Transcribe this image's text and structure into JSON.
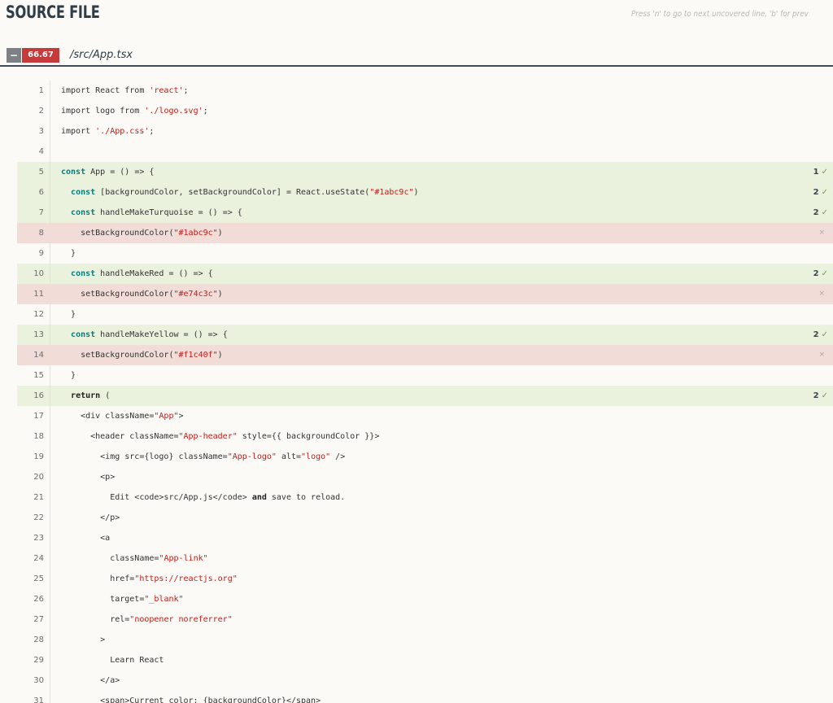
{
  "header": {
    "title": "SOURCE FILE",
    "hint": "Press 'n' to go to next uncovered line, 'b' for previous uncovered line"
  },
  "file": {
    "toggle_label": "−",
    "coverage_percent": "66.67",
    "path": "/src/App.tsx"
  },
  "colors": {
    "covered_bg": "#eaf1dd",
    "uncovered_bg": "#f1dcd8",
    "percent_badge": "#c53b3b"
  },
  "lines": [
    {
      "n": "1",
      "state": "",
      "hits": "",
      "tokens": [
        [
          "import React from ",
          ""
        ],
        [
          "'react'",
          "str"
        ],
        [
          ";",
          ""
        ]
      ]
    },
    {
      "n": "2",
      "state": "",
      "hits": "",
      "tokens": [
        [
          "import logo from ",
          ""
        ],
        [
          "'./logo.svg'",
          "str"
        ],
        [
          ";",
          ""
        ]
      ]
    },
    {
      "n": "3",
      "state": "",
      "hits": "",
      "tokens": [
        [
          "import ",
          ""
        ],
        [
          "'./App.css'",
          "str"
        ],
        [
          ";",
          ""
        ]
      ]
    },
    {
      "n": "4",
      "state": "",
      "hits": "",
      "tokens": []
    },
    {
      "n": "5",
      "state": "covered",
      "hits": "1",
      "tokens": [
        [
          "const",
          "kw"
        ],
        [
          " App = () => {",
          ""
        ]
      ]
    },
    {
      "n": "6",
      "state": "covered",
      "hits": "2",
      "tokens": [
        [
          "  ",
          ""
        ],
        [
          "const",
          "kw"
        ],
        [
          " [backgroundColor, setBackgroundColor] = React.useState(",
          ""
        ],
        [
          "\"#1abc9c\"",
          "str"
        ],
        [
          ")",
          ""
        ]
      ]
    },
    {
      "n": "7",
      "state": "covered",
      "hits": "2",
      "tokens": [
        [
          "  ",
          ""
        ],
        [
          "const",
          "kw"
        ],
        [
          " handleMakeTurquoise = () => {",
          ""
        ]
      ]
    },
    {
      "n": "8",
      "state": "uncovered",
      "hits": "",
      "tokens": [
        [
          "    setBackgroundColor(",
          ""
        ],
        [
          "\"#1abc9c\"",
          "str"
        ],
        [
          ")",
          ""
        ]
      ]
    },
    {
      "n": "9",
      "state": "",
      "hits": "",
      "tokens": [
        [
          "  }",
          ""
        ]
      ]
    },
    {
      "n": "10",
      "state": "covered",
      "hits": "2",
      "tokens": [
        [
          "  ",
          ""
        ],
        [
          "const",
          "kw"
        ],
        [
          " handleMakeRed = () => {",
          ""
        ]
      ]
    },
    {
      "n": "11",
      "state": "uncovered",
      "hits": "",
      "tokens": [
        [
          "    setBackgroundColor(",
          ""
        ],
        [
          "\"#e74c3c\"",
          "str"
        ],
        [
          ")",
          ""
        ]
      ]
    },
    {
      "n": "12",
      "state": "",
      "hits": "",
      "tokens": [
        [
          "  }",
          ""
        ]
      ]
    },
    {
      "n": "13",
      "state": "covered",
      "hits": "2",
      "tokens": [
        [
          "  ",
          ""
        ],
        [
          "const",
          "kw"
        ],
        [
          " handleMakeYellow = () => {",
          ""
        ]
      ]
    },
    {
      "n": "14",
      "state": "uncovered",
      "hits": "",
      "tokens": [
        [
          "    setBackgroundColor(",
          ""
        ],
        [
          "\"#f1c40f\"",
          "str"
        ],
        [
          ")",
          ""
        ]
      ]
    },
    {
      "n": "15",
      "state": "",
      "hits": "",
      "tokens": [
        [
          "  }",
          ""
        ]
      ]
    },
    {
      "n": "16",
      "state": "covered",
      "hits": "2",
      "tokens": [
        [
          "  ",
          ""
        ],
        [
          "return",
          "b"
        ],
        [
          " (",
          ""
        ]
      ]
    },
    {
      "n": "17",
      "state": "",
      "hits": "",
      "tokens": [
        [
          "    <div className=",
          ""
        ],
        [
          "\"App\"",
          "str"
        ],
        [
          ">",
          ""
        ]
      ]
    },
    {
      "n": "18",
      "state": "",
      "hits": "",
      "tokens": [
        [
          "      <header className=",
          ""
        ],
        [
          "\"App-header\"",
          "str"
        ],
        [
          " style={{ backgroundColor }}>",
          ""
        ]
      ]
    },
    {
      "n": "19",
      "state": "",
      "hits": "",
      "tokens": [
        [
          "        <img src={logo} className=",
          ""
        ],
        [
          "\"App-logo\"",
          "str"
        ],
        [
          " alt=",
          ""
        ],
        [
          "\"logo\"",
          "str"
        ],
        [
          " />",
          ""
        ]
      ]
    },
    {
      "n": "20",
      "state": "",
      "hits": "",
      "tokens": [
        [
          "        <p>",
          ""
        ]
      ]
    },
    {
      "n": "21",
      "state": "",
      "hits": "",
      "tokens": [
        [
          "          Edit <code>src/App.js</code> ",
          ""
        ],
        [
          "and",
          "b"
        ],
        [
          " save to reload.",
          ""
        ]
      ]
    },
    {
      "n": "22",
      "state": "",
      "hits": "",
      "tokens": [
        [
          "        </p>",
          ""
        ]
      ]
    },
    {
      "n": "23",
      "state": "",
      "hits": "",
      "tokens": [
        [
          "        <a",
          ""
        ]
      ]
    },
    {
      "n": "24",
      "state": "",
      "hits": "",
      "tokens": [
        [
          "          className=",
          ""
        ],
        [
          "\"App-link\"",
          "str"
        ]
      ]
    },
    {
      "n": "25",
      "state": "",
      "hits": "",
      "tokens": [
        [
          "          href=",
          ""
        ],
        [
          "\"https://reactjs.org\"",
          "str"
        ]
      ]
    },
    {
      "n": "26",
      "state": "",
      "hits": "",
      "tokens": [
        [
          "          target=",
          ""
        ],
        [
          "\"_blank\"",
          "str"
        ]
      ]
    },
    {
      "n": "27",
      "state": "",
      "hits": "",
      "tokens": [
        [
          "          rel=",
          ""
        ],
        [
          "\"noopener noreferrer\"",
          "str"
        ]
      ]
    },
    {
      "n": "28",
      "state": "",
      "hits": "",
      "tokens": [
        [
          "        >",
          ""
        ]
      ]
    },
    {
      "n": "29",
      "state": "",
      "hits": "",
      "tokens": [
        [
          "          Learn React",
          ""
        ]
      ]
    },
    {
      "n": "30",
      "state": "",
      "hits": "",
      "tokens": [
        [
          "        </a>",
          ""
        ]
      ]
    },
    {
      "n": "31",
      "state": "",
      "hits": "",
      "tokens": [
        [
          "        <span>Current color: {backgroundColor}</span>",
          ""
        ]
      ]
    }
  ]
}
